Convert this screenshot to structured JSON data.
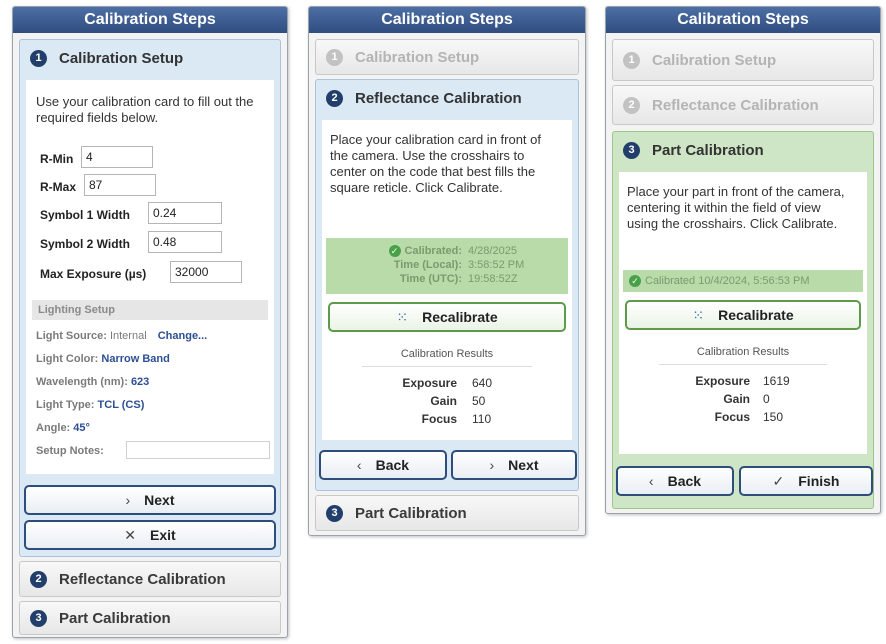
{
  "panels": [
    {
      "title": "Calibration Steps",
      "steps": [
        {
          "num": "1",
          "label": "Calibration Setup"
        },
        {
          "num": "2",
          "label": "Reflectance Calibration"
        },
        {
          "num": "3",
          "label": "Part Calibration"
        }
      ],
      "instructions": "Use your calibration card to fill out the required fields below.",
      "fields": [
        {
          "label": "R-Min",
          "value": "4"
        },
        {
          "label": "R-Max",
          "value": "87"
        },
        {
          "label": "Symbol 1 Width",
          "value": "0.24"
        },
        {
          "label": "Symbol 2 Width",
          "value": "0.48"
        },
        {
          "label": "Max Exposure (µs)",
          "value": "32000"
        }
      ],
      "lighting": {
        "header": "Lighting Setup",
        "source_label": "Light Source:",
        "source_value": "Internal",
        "change_link": "Change...",
        "color_label": "Light Color:",
        "color_value": "Narrow Band",
        "wavelength_label": "Wavelength (nm):",
        "wavelength_value": "623",
        "type_label": "Light Type:",
        "type_value": "TCL (CS)",
        "angle_label": "Angle:",
        "angle_value": "45°",
        "notes_label": "Setup Notes:",
        "notes_value": ""
      },
      "buttons": {
        "next": "Next",
        "exit": "Exit"
      }
    },
    {
      "title": "Calibration Steps",
      "steps": [
        {
          "num": "1",
          "label": "Calibration Setup"
        },
        {
          "num": "2",
          "label": "Reflectance Calibration"
        },
        {
          "num": "3",
          "label": "Part Calibration"
        }
      ],
      "instructions": "Place your calibration card in front of the camera. Use the crosshairs to center on the code that best fills the square reticle. Click Calibrate.",
      "status": {
        "calibrated_label": "Calibrated:",
        "calibrated_value": "4/28/2025",
        "local_label": "Time (Local):",
        "local_value": "3:58:52 PM",
        "utc_label": "Time (UTC):",
        "utc_value": "19:58:52Z"
      },
      "recalibrate": "Recalibrate",
      "results_title": "Calibration Results",
      "results": [
        {
          "label": "Exposure",
          "value": "640"
        },
        {
          "label": "Gain",
          "value": "50"
        },
        {
          "label": "Focus",
          "value": "110"
        }
      ],
      "buttons": {
        "back": "Back",
        "next": "Next"
      }
    },
    {
      "title": "Calibration Steps",
      "steps": [
        {
          "num": "1",
          "label": "Calibration Setup"
        },
        {
          "num": "2",
          "label": "Reflectance Calibration"
        },
        {
          "num": "3",
          "label": "Part Calibration"
        }
      ],
      "instructions": "Place your part in front of the camera, centering it within the field of view using the crosshairs. Click Calibrate.",
      "status": {
        "text": "Calibrated 10/4/2024, 5:56:53 PM"
      },
      "recalibrate": "Recalibrate",
      "results_title": "Calibration Results",
      "results": [
        {
          "label": "Exposure",
          "value": "1619"
        },
        {
          "label": "Gain",
          "value": "0"
        },
        {
          "label": "Focus",
          "value": "150"
        }
      ],
      "buttons": {
        "back": "Back",
        "finish": "Finish"
      }
    }
  ],
  "icons": {
    "chevron_right": "›",
    "chevron_left": "‹",
    "close": "✕",
    "check": "✓",
    "reticle": "⁙"
  },
  "colors": {
    "title_bar": "#2f4d7f",
    "active_blue": "#dbe9f5",
    "active_green": "#cfe6c6",
    "calibrated_banner": "#b9dba9",
    "link": "#2c4f93"
  }
}
